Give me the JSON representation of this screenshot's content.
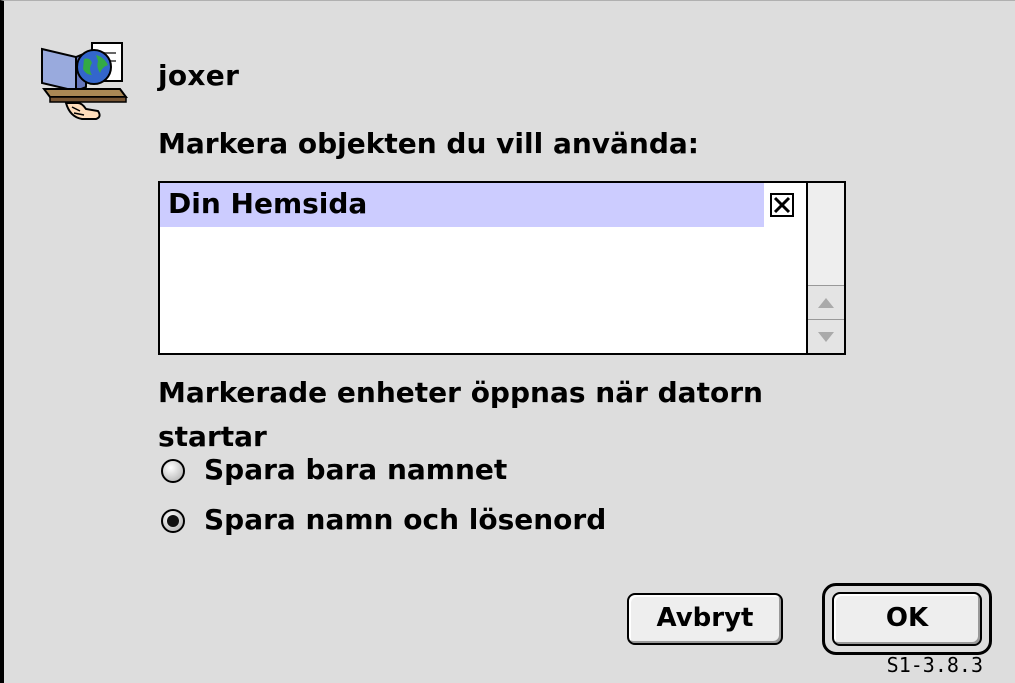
{
  "dialog": {
    "icon": "network-globe-folder-icon",
    "user_name": "joxer",
    "prompt": "Markera objekten du vill använda:",
    "list_items": [
      {
        "label": "Din Hemsida",
        "checked": true,
        "selected": true
      }
    ],
    "info_text": "Markerade enheter öppnas när datorn startar",
    "radio_options": [
      {
        "label": "Spara bara namnet",
        "selected": false
      },
      {
        "label": "Spara namn och lösenord",
        "selected": true
      }
    ],
    "cancel_label": "Avbryt",
    "ok_label": "OK",
    "version": "S1-3.8.3"
  },
  "colors": {
    "window_bg": "#dddddd",
    "selection": "#ccccff"
  }
}
